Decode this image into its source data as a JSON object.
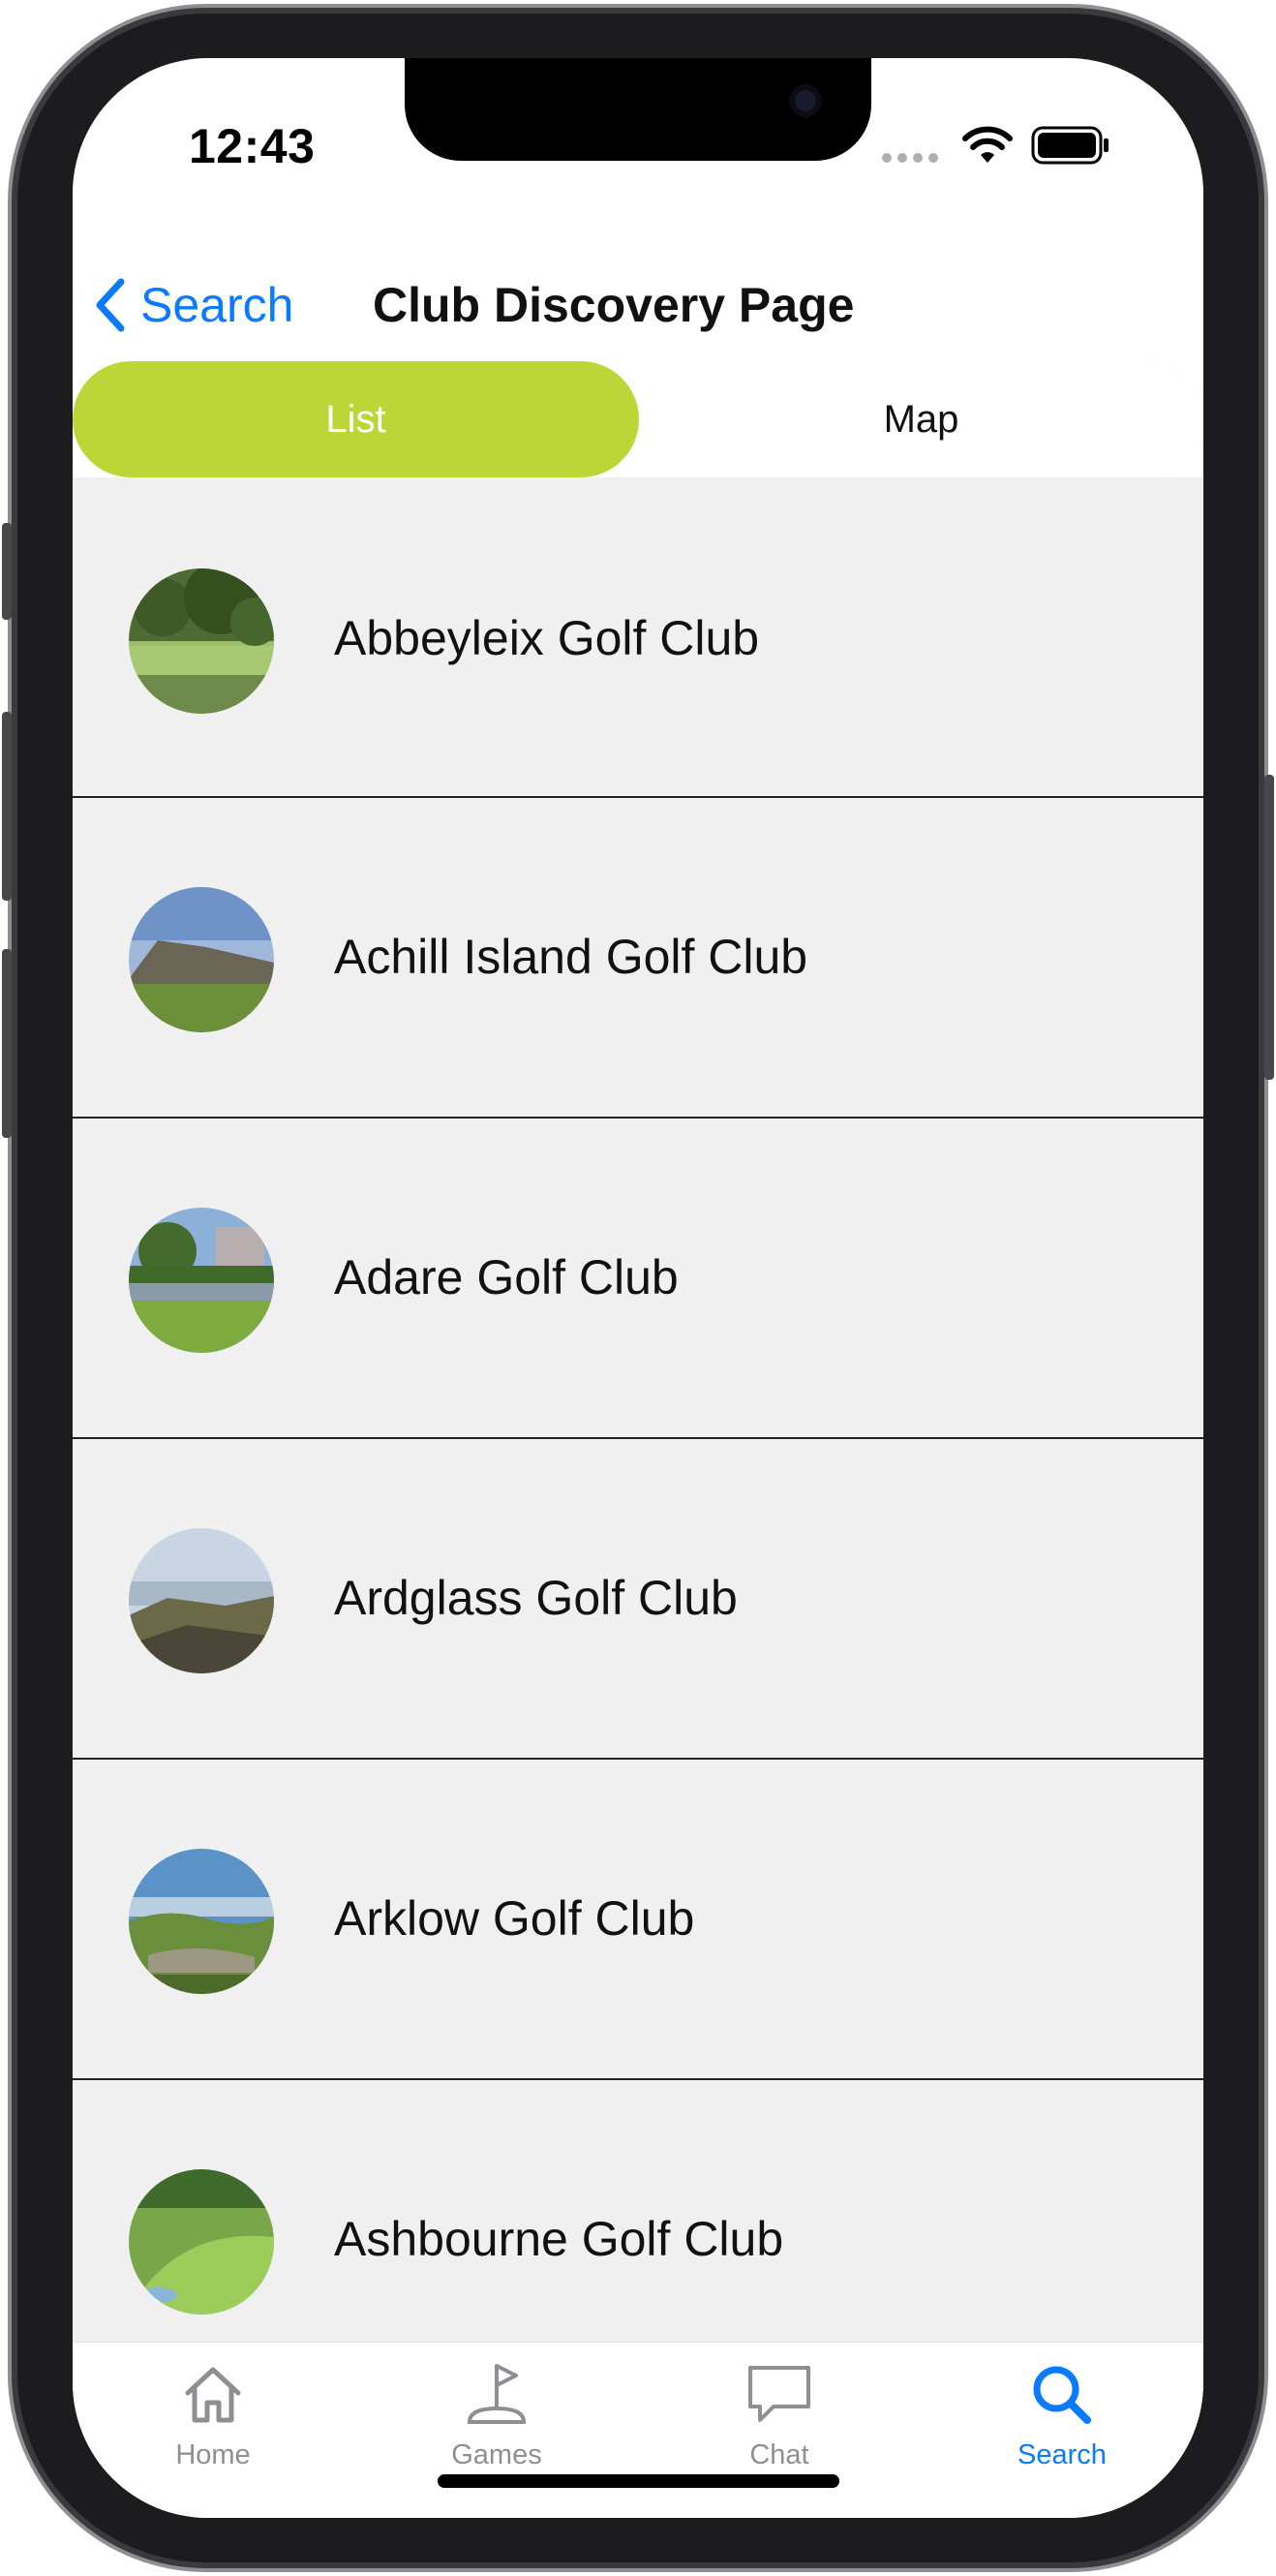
{
  "status_bar": {
    "time": "12:43",
    "wifi_icon": "wifi-icon",
    "battery_icon": "battery-icon"
  },
  "nav": {
    "back_label": "Search",
    "back_icon": "chevron-left-icon",
    "title": "Club Discovery Page"
  },
  "segment": {
    "options": [
      "List",
      "Map"
    ],
    "selected": "List",
    "accent_color": "#bcd637"
  },
  "clubs": [
    {
      "name": "Abbeyleix Golf Club",
      "thumb": "parkland-trees-photo"
    },
    {
      "name": "Achill Island Golf Club",
      "thumb": "coastal-links-photo"
    },
    {
      "name": "Adare Golf Club",
      "thumb": "manor-house-lake-photo"
    },
    {
      "name": "Ardglass Golf Club",
      "thumb": "seaside-rocks-photo"
    },
    {
      "name": "Arklow Golf Club",
      "thumb": "links-dunes-photo"
    },
    {
      "name": "Ashbourne Golf Club",
      "thumb": "fairway-green-photo"
    }
  ],
  "tabbar": {
    "tabs": [
      {
        "label": "Home",
        "icon": "house-icon"
      },
      {
        "label": "Games",
        "icon": "golf-flag-icon"
      },
      {
        "label": "Chat",
        "icon": "chat-bubble-icon"
      },
      {
        "label": "Search",
        "icon": "magnifier-icon"
      }
    ],
    "active": "Search",
    "active_color": "#0a7aff",
    "inactive_color": "#8e8e93"
  }
}
